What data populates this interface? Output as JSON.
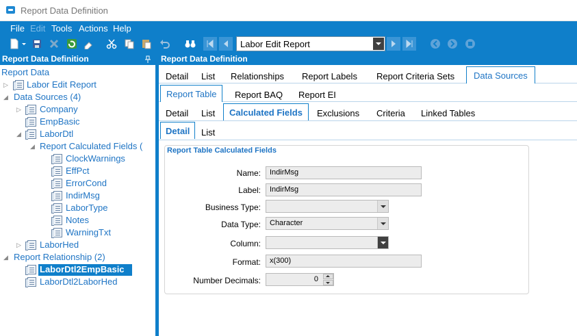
{
  "window": {
    "title": "Report Data Definition"
  },
  "menu": {
    "file": "File",
    "edit": "Edit",
    "tools": "Tools",
    "actions": "Actions",
    "help": "Help"
  },
  "toolbar": {
    "report_selected": "Labor Edit Report"
  },
  "left_pane": {
    "header": "Report Data Definition",
    "pin_icon": "pin-icon",
    "tree": [
      {
        "label": "Report Data"
      },
      {
        "label": "Labor Edit Report"
      },
      {
        "label": "Data Sources (4)"
      },
      {
        "label": "Company"
      },
      {
        "label": "EmpBasic"
      },
      {
        "label": "LaborDtl"
      },
      {
        "label": "Report Calculated Fields ("
      },
      {
        "label": "ClockWarnings"
      },
      {
        "label": "EffPct"
      },
      {
        "label": "ErrorCond"
      },
      {
        "label": "IndirMsg"
      },
      {
        "label": "LaborType"
      },
      {
        "label": "Notes"
      },
      {
        "label": "WarningTxt"
      },
      {
        "label": "LaborHed"
      },
      {
        "label": "Report Relationship (2)"
      },
      {
        "label": "LaborDtl2EmpBasic"
      },
      {
        "label": "LaborDtl2LaborHed"
      }
    ]
  },
  "right_pane": {
    "header": "Report Data Definition",
    "tabs_l1": [
      "Detail",
      "List",
      "Relationships",
      "Report Labels",
      "Report Criteria Sets",
      "Data Sources"
    ],
    "tabs_l2": [
      "Report Table",
      "Report BAQ",
      "Report EI"
    ],
    "tabs_l3": [
      "Detail",
      "List",
      "Calculated Fields",
      "Exclusions",
      "Criteria",
      "Linked Tables"
    ],
    "tabs_l4": [
      "Detail",
      "List"
    ],
    "group_title": "Report Table Calculated Fields",
    "fields": {
      "name_label": "Name:",
      "name_value": "IndirMsg",
      "label_label": "Label:",
      "label_value": "IndirMsg",
      "business_type_label": "Business Type:",
      "business_type_value": "",
      "data_type_label": "Data Type:",
      "data_type_value": "Character",
      "column_label": "Column:",
      "column_value": "",
      "format_label": "Format:",
      "format_value": "x(300)",
      "decimals_label": "Number Decimals:",
      "decimals_value": "0"
    }
  },
  "colors": {
    "accent": "#0f7fca",
    "link": "#1e74c4"
  }
}
